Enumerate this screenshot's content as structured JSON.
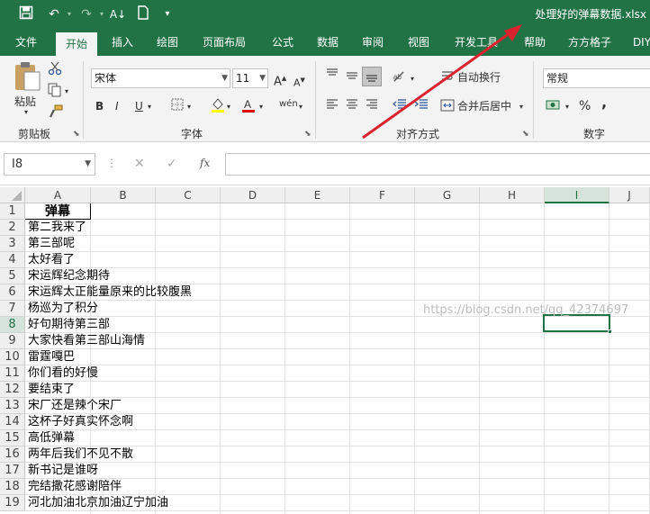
{
  "quick_access": {
    "save_icon": "save-icon",
    "undo_icon": "undo-icon",
    "redo_icon": "redo-icon",
    "sort_icon": "sort-az-icon",
    "new_icon": "new-file-icon",
    "customize_icon": "customize-icon"
  },
  "title": {
    "filename": "处理好的弹幕数据.xlsx"
  },
  "tabs": [
    {
      "label": "文件"
    },
    {
      "label": "开始"
    },
    {
      "label": "插入"
    },
    {
      "label": "绘图"
    },
    {
      "label": "页面布局"
    },
    {
      "label": "公式"
    },
    {
      "label": "数据"
    },
    {
      "label": "审阅"
    },
    {
      "label": "视图"
    },
    {
      "label": "开发工具"
    },
    {
      "label": "帮助"
    },
    {
      "label": "方方格子"
    },
    {
      "label": "DIY"
    }
  ],
  "ribbon": {
    "paste_label": "粘贴",
    "clipboard_label": "剪贴板",
    "font_name": "宋体",
    "font_size": "11",
    "bold": "B",
    "italic": "I",
    "underline": "U",
    "font_label": "字体",
    "wrap_text": "自动换行",
    "merge_center": "合并后居中",
    "alignment_label": "对齐方式",
    "number_format": "常规",
    "percent": "%",
    "comma": ",",
    "number_label": "数字"
  },
  "formula_bar": {
    "name_box": "I8",
    "cancel": "✕",
    "enter": "✓",
    "fx": "fx",
    "content": ""
  },
  "grid": {
    "columns": [
      "A",
      "B",
      "C",
      "D",
      "E",
      "F",
      "G",
      "H",
      "I",
      "J"
    ],
    "selected_column": "I",
    "selected_row": "8",
    "rows": [
      {
        "num": "1",
        "a": "弹幕"
      },
      {
        "num": "2",
        "a": "第二我来了"
      },
      {
        "num": "3",
        "a": "第三部呢"
      },
      {
        "num": "4",
        "a": "太好看了"
      },
      {
        "num": "5",
        "a": "宋运辉纪念期待"
      },
      {
        "num": "6",
        "a": "宋运辉太正能量原来的比较腹黑"
      },
      {
        "num": "7",
        "a": "杨巡为了积分"
      },
      {
        "num": "8",
        "a": "好句期待第三部"
      },
      {
        "num": "9",
        "a": "大家快看第三部山海情"
      },
      {
        "num": "10",
        "a": "雷霆嘎巴"
      },
      {
        "num": "11",
        "a": "你们看的好慢"
      },
      {
        "num": "12",
        "a": "要结束了"
      },
      {
        "num": "13",
        "a": "宋厂还是辣个宋厂"
      },
      {
        "num": "14",
        "a": "这杯子好真实怀念啊"
      },
      {
        "num": "15",
        "a": "高低弹幕"
      },
      {
        "num": "16",
        "a": "两年后我们不见不散"
      },
      {
        "num": "17",
        "a": "新书记是谁呀"
      },
      {
        "num": "18",
        "a": "完结撒花感谢陪伴"
      },
      {
        "num": "19",
        "a": "河北加油北京加油辽宁加油"
      }
    ]
  },
  "watermark": "https://blog.csdn.net/qq_42374697",
  "colors": {
    "excel_green": "#217346",
    "annotation_arrow": "#d9232e"
  }
}
